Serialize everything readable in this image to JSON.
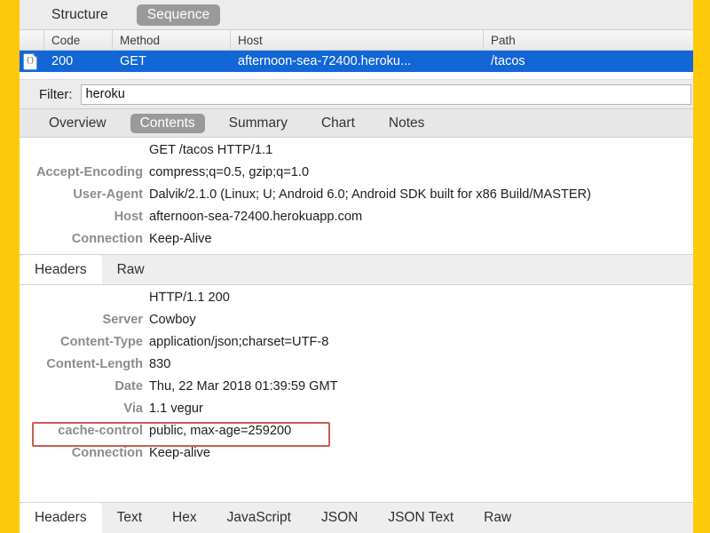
{
  "window": {
    "frame_color": "#ffc90b",
    "accent_selection": "#1266d6",
    "annotation_color": "#c0392b"
  },
  "view_mode": {
    "options": [
      "Structure",
      "Sequence"
    ],
    "structure_label": "Structure",
    "sequence_label": "Sequence",
    "selected": "Sequence"
  },
  "request_table": {
    "columns": [
      "",
      "Code",
      "Method",
      "Host",
      "Path"
    ],
    "headers": {
      "icon": "",
      "code": "Code",
      "method": "Method",
      "host": "Host",
      "path": "Path"
    },
    "rows": [
      {
        "icon": "json-file-icon",
        "icon_glyph": "{}",
        "code": "200",
        "method": "GET",
        "host": "afternoon-sea-72400.heroku...",
        "path": "/tacos",
        "selected": true
      }
    ]
  },
  "filter": {
    "label": "Filter:",
    "value": "heroku",
    "placeholder": ""
  },
  "detail_tabs": {
    "items": [
      "Overview",
      "Contents",
      "Summary",
      "Chart",
      "Notes"
    ],
    "overview": "Overview",
    "contents": "Contents",
    "summary": "Summary",
    "chart": "Chart",
    "notes": "Notes",
    "selected": "Contents"
  },
  "request_headers": {
    "request_line_key": "",
    "request_line_value": "GET /tacos HTTP/1.1",
    "rows": [
      {
        "key": "",
        "value": "GET /tacos HTTP/1.1"
      },
      {
        "key": "Accept-Encoding",
        "value": "compress;q=0.5, gzip;q=1.0"
      },
      {
        "key": "User-Agent",
        "value": "Dalvik/2.1.0 (Linux; U; Android 6.0; Android SDK built for x86 Build/MASTER)"
      },
      {
        "key": "Host",
        "value": "afternoon-sea-72400.herokuapp.com"
      },
      {
        "key": "Connection",
        "value": "Keep-Alive"
      }
    ]
  },
  "request_subtabs": {
    "items": [
      "Headers",
      "Raw"
    ],
    "headers": "Headers",
    "raw": "Raw",
    "selected": "Headers"
  },
  "response_headers": {
    "rows": [
      {
        "key": "",
        "value": "HTTP/1.1 200"
      },
      {
        "key": "Server",
        "value": "Cowboy"
      },
      {
        "key": "Content-Type",
        "value": "application/json;charset=UTF-8"
      },
      {
        "key": "Content-Length",
        "value": "830"
      },
      {
        "key": "Date",
        "value": "Thu, 22 Mar 2018 01:39:59 GMT"
      },
      {
        "key": "Via",
        "value": "1.1 vegur"
      },
      {
        "key": "cache-control",
        "value": "public, max-age=259200",
        "highlighted": true
      },
      {
        "key": "Connection",
        "value": "Keep-alive"
      }
    ]
  },
  "response_subtabs": {
    "items": [
      "Headers",
      "Text",
      "Hex",
      "JavaScript",
      "JSON",
      "JSON Text",
      "Raw"
    ],
    "headers": "Headers",
    "text": "Text",
    "hex": "Hex",
    "javascript": "JavaScript",
    "json": "JSON",
    "json_text": "JSON Text",
    "raw": "Raw",
    "selected": "Headers"
  }
}
